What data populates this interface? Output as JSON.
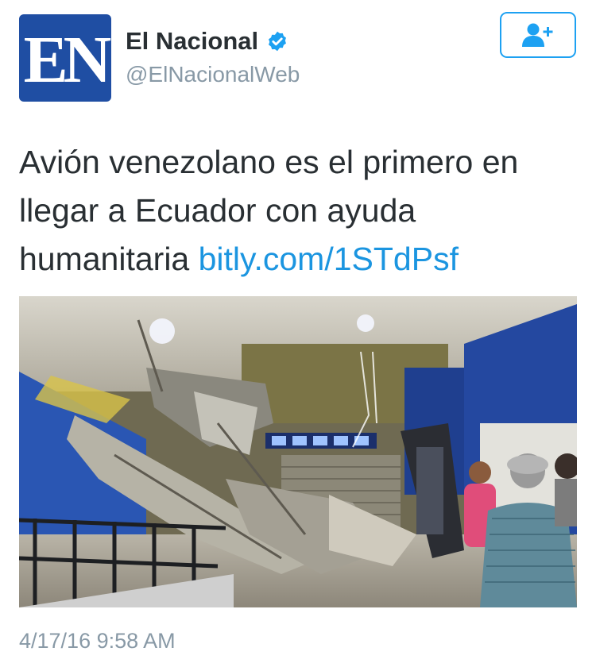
{
  "author": {
    "avatar_text": "EN",
    "display_name": "El Nacional",
    "username": "@ElNacionalWeb",
    "verified": true
  },
  "follow_button": {
    "icon": "add-user-icon"
  },
  "tweet": {
    "text": "Avión venezolano es el primero en llegar a Ecuador con ayuda humanitaria ",
    "link": "bitly.com/1STdPsf",
    "timestamp": "4/17/16 9:58 AM"
  },
  "colors": {
    "brand_blue": "#1da1f2",
    "link_blue": "#1b95e0",
    "avatar_blue": "#1f4ea3",
    "gray_text": "#8899a6"
  }
}
